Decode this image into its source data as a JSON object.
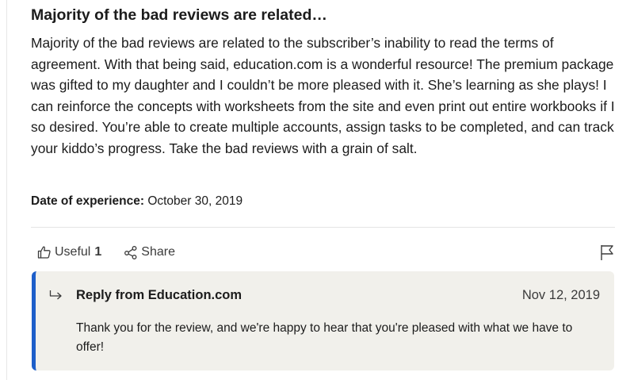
{
  "review": {
    "title": "Majority of the bad reviews are related…",
    "body": "Majority of the bad reviews are related to the subscriber’s inability to read the terms of agreement. With that being said, education.com is a wonderful resource! The premium package was gifted to my daughter and I couldn’t be more pleased with it. She’s learning as she plays! I can reinforce the concepts with worksheets from the site and even print out entire workbooks if I so desired. You’re able to create multiple accounts, assign tasks to be completed, and can track your kiddo’s progress. Take the bad reviews with a grain of salt.",
    "date_label": "Date of experience:",
    "date_value": "October 30, 2019"
  },
  "actions": {
    "useful_label": "Useful",
    "useful_count": "1",
    "share_label": "Share",
    "useful_icon": "thumbs-up-icon",
    "share_icon": "share-icon",
    "flag_icon": "flag-icon"
  },
  "reply": {
    "icon": "reply-arrow-icon",
    "title": "Reply from Education.com",
    "date": "Nov 12, 2019",
    "text": "Thank you for the review, and we're happy to hear that you're pleased with what we have to offer!",
    "accent_color": "#1d5ec9",
    "background_color": "#f1f0eb"
  }
}
